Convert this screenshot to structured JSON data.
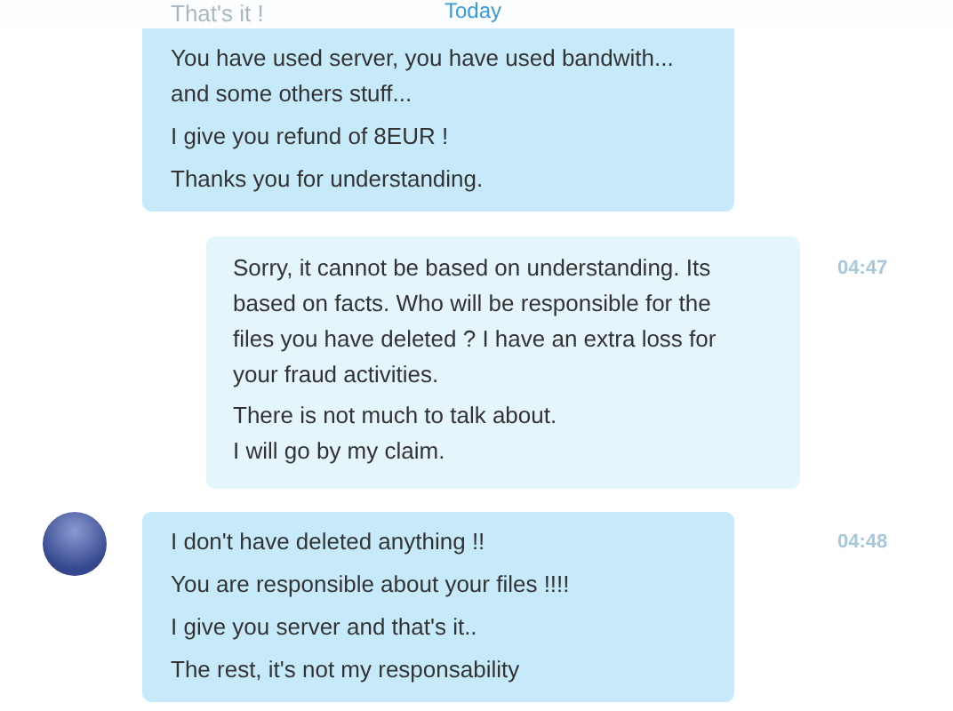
{
  "header": {
    "faded_text": "That's it !",
    "date": "Today"
  },
  "messages": [
    {
      "kind": "incoming",
      "avatar": false,
      "paragraphs": [
        [
          "You have used server, you have used bandwith...",
          "and some others stuff..."
        ],
        [
          "I give you refund of 8EUR !"
        ],
        [
          "Thanks you for understanding."
        ]
      ]
    },
    {
      "kind": "outgoing",
      "avatar": false,
      "time": "04:47",
      "paragraphs": [
        [
          "Sorry, it cannot be based on understanding. Its",
          "based on facts. Who will be responsible for the",
          "files you have deleted ? I have an extra loss for",
          "your fraud activities."
        ],
        [
          "There is not much to talk about.",
          "I will go by my claim."
        ]
      ]
    },
    {
      "kind": "incoming",
      "avatar": true,
      "time": "04:48",
      "paragraphs": [
        [
          "I don't have deleted anything !!"
        ],
        [
          "You are responsible about your files !!!!"
        ],
        [
          "I give you server and that's it.."
        ],
        [
          "The rest, it's not my responsability"
        ]
      ]
    }
  ]
}
